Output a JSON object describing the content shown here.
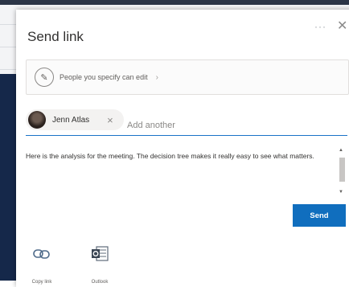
{
  "dialog": {
    "title": "Send link",
    "more_icon": "more-icon",
    "close_icon": "close-icon"
  },
  "permission": {
    "icon": "pencil-icon",
    "label": "People you specify can edit",
    "chevron": "›"
  },
  "recipients": [
    {
      "name": "Jenn Atlas",
      "remove": "×"
    }
  ],
  "recipient_input": {
    "placeholder": "Add another"
  },
  "message": {
    "text": "Here is the analysis for the meeting. The decision tree makes it really easy to see what matters."
  },
  "send_button": {
    "label": "Send"
  },
  "actions": [
    {
      "label": "Copy link",
      "icon": "link-icon"
    },
    {
      "label": "Outlook",
      "icon": "outlook-icon"
    }
  ],
  "colors": {
    "accent": "#106ebe",
    "background_page": "#15284a"
  }
}
